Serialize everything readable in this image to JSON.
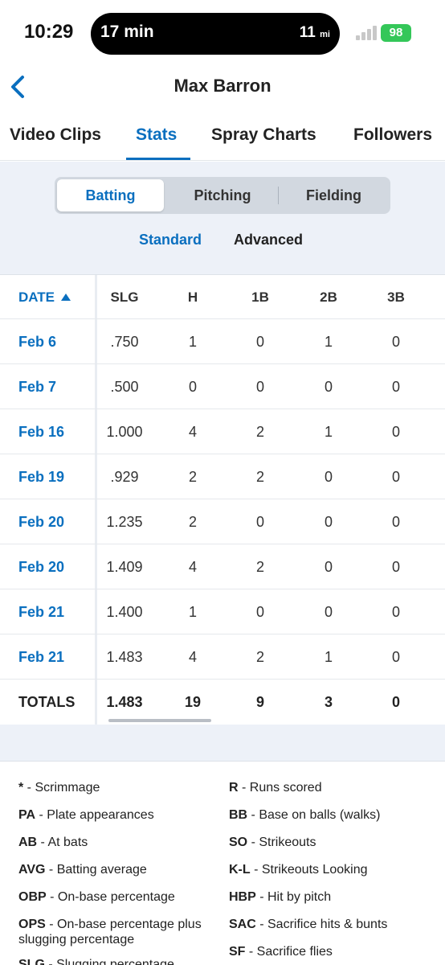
{
  "status_bar": {
    "time": "10:29",
    "activity_label": "17 min",
    "activity_distance": "11",
    "activity_unit": "mi",
    "battery": "98"
  },
  "header": {
    "title": "Max Barron"
  },
  "tabs": [
    {
      "label": "Video Clips",
      "active": false
    },
    {
      "label": "Stats",
      "active": true
    },
    {
      "label": "Spray Charts",
      "active": false
    },
    {
      "label": "Followers",
      "active": false
    }
  ],
  "stat_type": {
    "options": [
      "Batting",
      "Pitching",
      "Fielding"
    ],
    "selected": "Batting"
  },
  "view_mode": {
    "options": [
      "Standard",
      "Advanced"
    ],
    "selected": "Standard"
  },
  "table": {
    "columns": [
      "DATE",
      "SLG",
      "H",
      "1B",
      "2B",
      "3B"
    ],
    "rows": [
      {
        "date": "Feb 6",
        "slg": ".750",
        "h": "1",
        "b1": "0",
        "b2": "1",
        "b3": "0"
      },
      {
        "date": "Feb 7",
        "slg": ".500",
        "h": "0",
        "b1": "0",
        "b2": "0",
        "b3": "0"
      },
      {
        "date": "Feb 16",
        "slg": "1.000",
        "h": "4",
        "b1": "2",
        "b2": "1",
        "b3": "0"
      },
      {
        "date": "Feb 19",
        "slg": ".929",
        "h": "2",
        "b1": "2",
        "b2": "0",
        "b3": "0"
      },
      {
        "date": "Feb 20",
        "slg": "1.235",
        "h": "2",
        "b1": "0",
        "b2": "0",
        "b3": "0"
      },
      {
        "date": "Feb 20",
        "slg": "1.409",
        "h": "4",
        "b1": "2",
        "b2": "0",
        "b3": "0"
      },
      {
        "date": "Feb 21",
        "slg": "1.400",
        "h": "1",
        "b1": "0",
        "b2": "0",
        "b3": "0"
      },
      {
        "date": "Feb 21",
        "slg": "1.483",
        "h": "4",
        "b1": "2",
        "b2": "1",
        "b3": "0"
      }
    ],
    "totals": {
      "label": "TOTALS",
      "slg": "1.483",
      "h": "19",
      "b1": "9",
      "b2": "3",
      "b3": "0"
    }
  },
  "legend": {
    "left": [
      {
        "abbr": "*",
        "desc": "Scrimmage"
      },
      {
        "abbr": "PA",
        "desc": "Plate appearances"
      },
      {
        "abbr": "AB",
        "desc": "At bats"
      },
      {
        "abbr": "AVG",
        "desc": "Batting average"
      },
      {
        "abbr": "OBP",
        "desc": "On-base percentage"
      },
      {
        "abbr": "OPS",
        "desc": "On-base percentage plus slugging percentage"
      },
      {
        "abbr": "SLG",
        "desc": "Slugging percentage"
      }
    ],
    "right": [
      {
        "abbr": "R",
        "desc": "Runs scored"
      },
      {
        "abbr": "BB",
        "desc": "Base on balls (walks)"
      },
      {
        "abbr": "SO",
        "desc": "Strikeouts"
      },
      {
        "abbr": "K-L",
        "desc": "Strikeouts Looking"
      },
      {
        "abbr": "HBP",
        "desc": "Hit by pitch"
      },
      {
        "abbr": "SAC",
        "desc": "Sacrifice hits & bunts"
      },
      {
        "abbr": "SF",
        "desc": "Sacrifice flies"
      }
    ]
  },
  "colors": {
    "accent": "#0a6fbf",
    "band": "#edf1f8",
    "battery": "#34c759"
  }
}
